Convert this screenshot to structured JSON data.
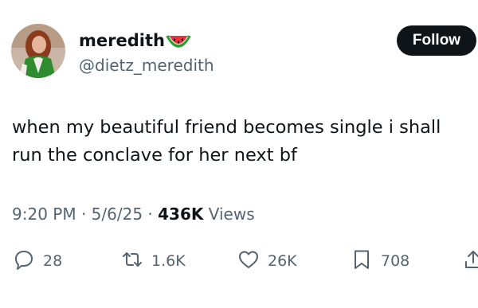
{
  "author": {
    "display_name": "meredith",
    "handle": "@dietz_meredith",
    "name_emoji_icon": "watermelon-icon"
  },
  "follow_button": {
    "label": "Follow"
  },
  "tweet": {
    "text_lines": [
      "when my beautiful friend becomes single i shall",
      "run the conclave for her next bf"
    ],
    "time": "9:20 PM",
    "date": "5/6/25",
    "separator": "·",
    "views_count": "436K",
    "views_label": "Views"
  },
  "actions": {
    "reply": {
      "icon": "reply-icon",
      "count": "28"
    },
    "repost": {
      "icon": "repost-icon",
      "count": "1.6K"
    },
    "like": {
      "icon": "heart-icon",
      "count": "26K"
    },
    "bookmark": {
      "icon": "bookmark-icon",
      "count": "708"
    },
    "share": {
      "icon": "share-icon"
    }
  },
  "colors": {
    "text_primary": "#0f1419",
    "text_secondary": "#536471",
    "follow_bg": "#0f1419",
    "follow_text": "#ffffff"
  }
}
